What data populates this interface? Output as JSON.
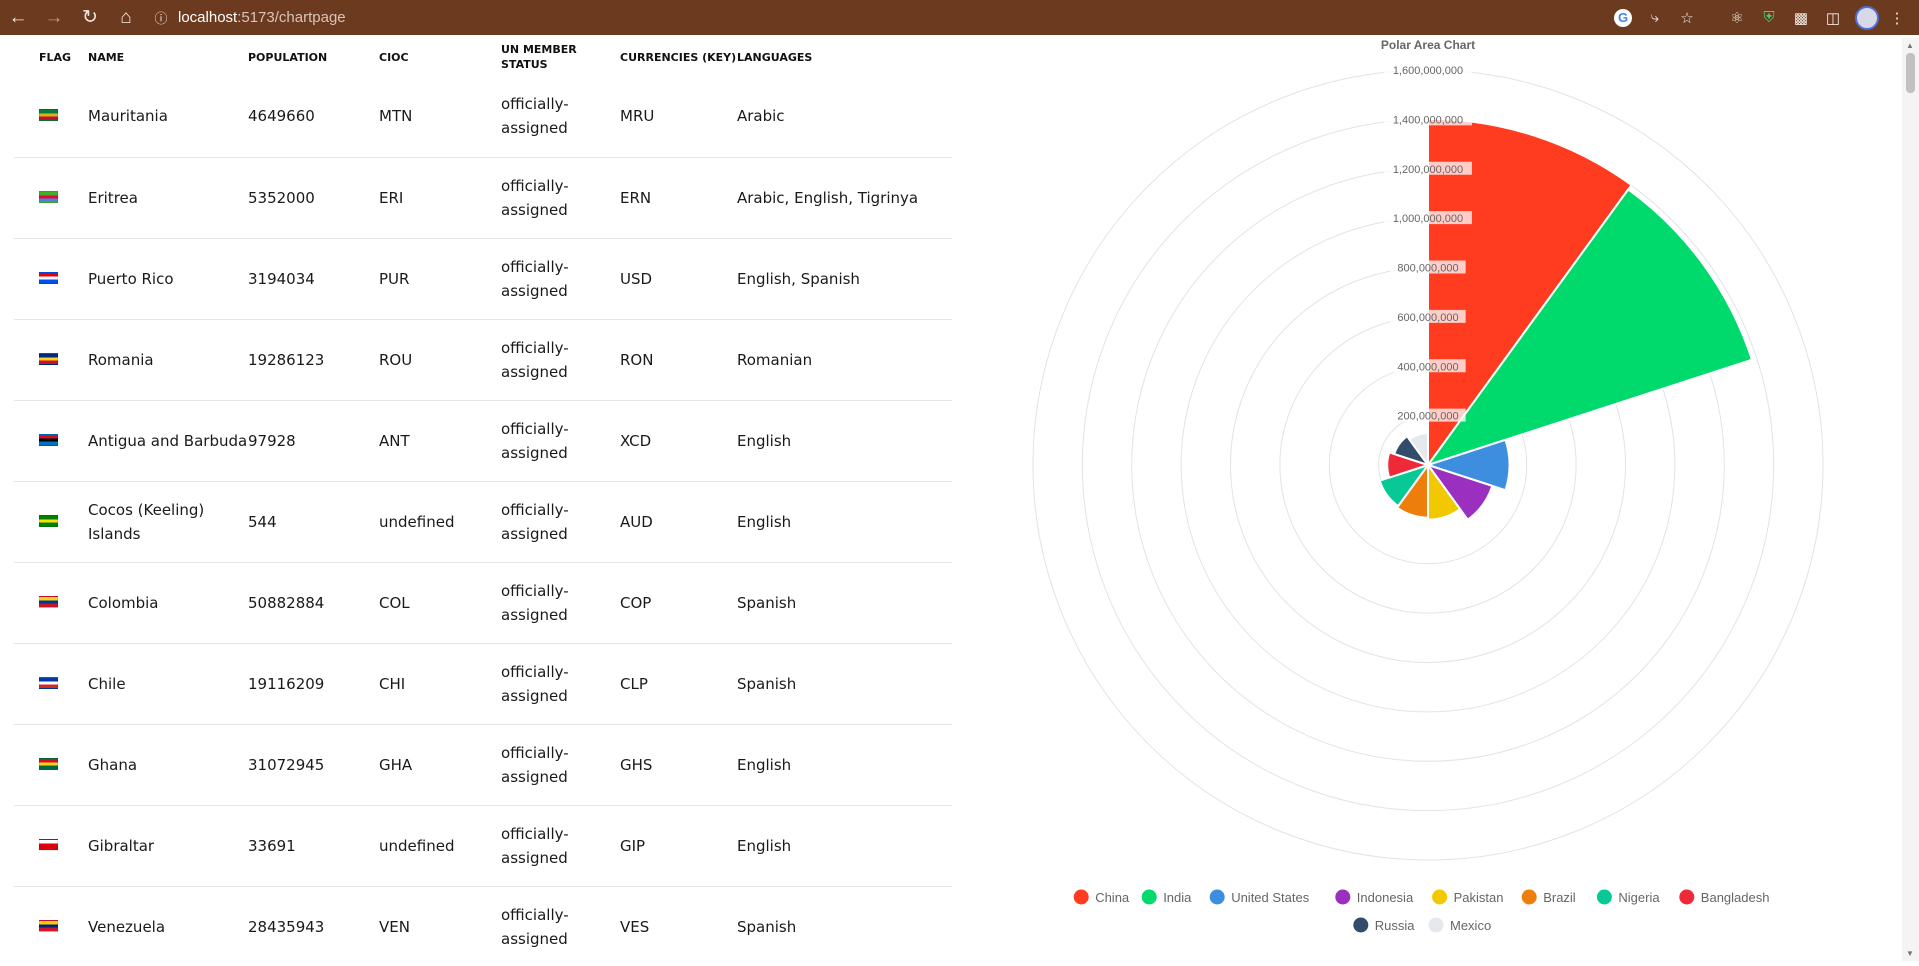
{
  "browser": {
    "url_host": "localhost",
    "url_path": ":5173/chartpage"
  },
  "table": {
    "headers": [
      "FLAG",
      "NAME",
      "POPULATION",
      "CIOC",
      "UN MEMBER STATUS",
      "CURRENCIES (KEY)",
      "LANGUAGES"
    ],
    "rows": [
      {
        "flag": [
          "#0b7a3d",
          "#d4b71b",
          "#c8102e"
        ],
        "name": "Mauritania",
        "population": "4649660",
        "cioc": "MTN",
        "un": "officially-assigned",
        "currency": "MRU",
        "languages": "Arabic"
      },
      {
        "flag": [
          "#43b02a",
          "#ea0437",
          "#4189dd"
        ],
        "name": "Eritrea",
        "population": "5352000",
        "cioc": "ERI",
        "un": "officially-assigned",
        "currency": "ERN",
        "languages": "Arabic, English, Tigrinya"
      },
      {
        "flag": [
          "#ed0000",
          "#ffffff",
          "#0050f0"
        ],
        "name": "Puerto Rico",
        "population": "3194034",
        "cioc": "PUR",
        "un": "officially-assigned",
        "currency": "USD",
        "languages": "English, Spanish"
      },
      {
        "flag": [
          "#002b7f",
          "#fcd116",
          "#ce1126"
        ],
        "name": "Romania",
        "population": "19286123",
        "cioc": "ROU",
        "un": "officially-assigned",
        "currency": "RON",
        "languages": "Romanian"
      },
      {
        "flag": [
          "#ce1126",
          "#000000",
          "#0072c6"
        ],
        "name": "Antigua and Barbuda",
        "population": "97928",
        "cioc": "ANT",
        "un": "officially-assigned",
        "currency": "XCD",
        "languages": "English"
      },
      {
        "flag": [
          "#008000",
          "#ffe000",
          "#008000"
        ],
        "name": "Cocos (Keeling) Islands",
        "population": "544",
        "cioc": "undefined",
        "un": "officially-assigned",
        "currency": "AUD",
        "languages": "English"
      },
      {
        "flag": [
          "#fcd116",
          "#003893",
          "#ce1126"
        ],
        "name": "Colombia",
        "population": "50882884",
        "cioc": "COL",
        "un": "officially-assigned",
        "currency": "COP",
        "languages": "Spanish"
      },
      {
        "flag": [
          "#0039a6",
          "#ffffff",
          "#d52b1e"
        ],
        "name": "Chile",
        "population": "19116209",
        "cioc": "CHI",
        "un": "officially-assigned",
        "currency": "CLP",
        "languages": "Spanish"
      },
      {
        "flag": [
          "#ce1126",
          "#fcd116",
          "#006b3f"
        ],
        "name": "Ghana",
        "population": "31072945",
        "cioc": "GHA",
        "un": "officially-assigned",
        "currency": "GHS",
        "languages": "English"
      },
      {
        "flag": [
          "#ffffff",
          "#da000c",
          "#da000c"
        ],
        "name": "Gibraltar",
        "population": "33691",
        "cioc": "undefined",
        "un": "officially-assigned",
        "currency": "GIP",
        "languages": "English"
      },
      {
        "flag": [
          "#ffcc00",
          "#00247d",
          "#cf142b"
        ],
        "name": "Venezuela",
        "population": "28435943",
        "cioc": "VEN",
        "un": "officially-assigned",
        "currency": "VES",
        "languages": "Spanish"
      }
    ]
  },
  "chart_data": {
    "type": "polarArea",
    "title": "Polar Area Chart",
    "rmax": 1600000000,
    "tick_labels": [
      "200,000,000",
      "400,000,000",
      "600,000,000",
      "800,000,000",
      "1,000,000,000",
      "1,200,000,000",
      "1,400,000,000",
      "1,600,000,000"
    ],
    "tick_values": [
      200000000,
      400000000,
      600000000,
      800000000,
      1000000000,
      1200000000,
      1400000000,
      1600000000
    ],
    "categories": [
      "China",
      "India",
      "United States",
      "Indonesia",
      "Pakistan",
      "Brazil",
      "Nigeria",
      "Bangladesh",
      "Russia",
      "Mexico"
    ],
    "values": [
      1402000000,
      1380000000,
      330000000,
      274000000,
      221000000,
      213000000,
      206000000,
      165000000,
      144000000,
      129000000
    ],
    "colors": [
      "#ff3b20",
      "#00d96b",
      "#3e8ee0",
      "#9b2fbf",
      "#f2c800",
      "#ee7e0c",
      "#06c996",
      "#ef2a38",
      "#324d6b",
      "#e5e8ec"
    ],
    "legend": "bottom",
    "grid": true
  }
}
